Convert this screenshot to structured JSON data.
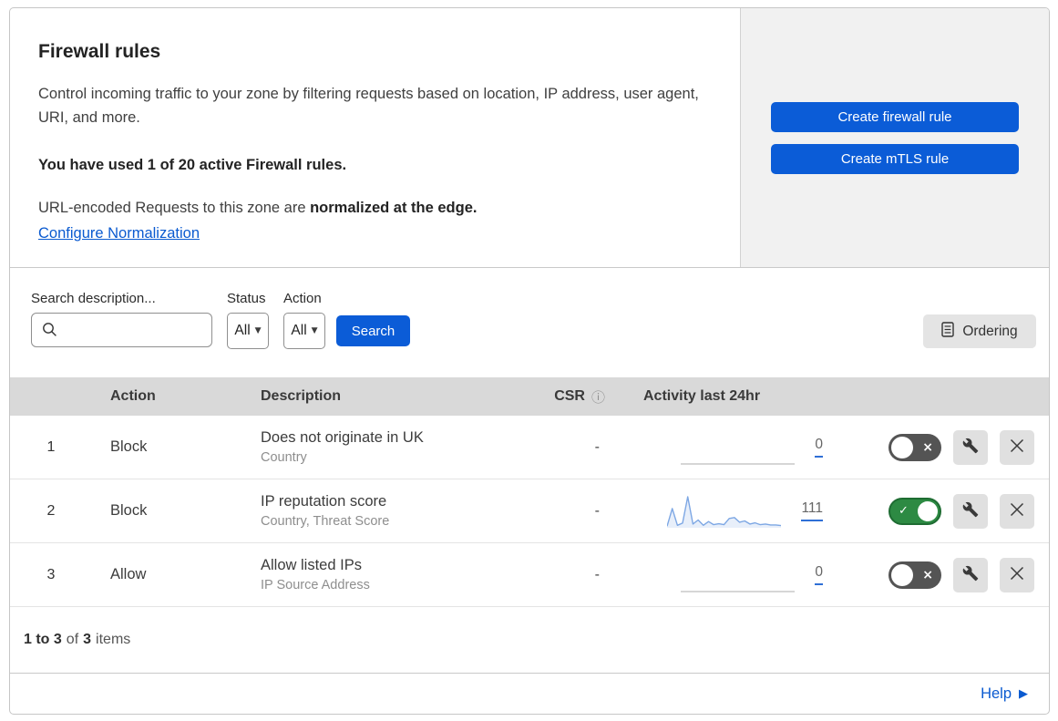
{
  "header": {
    "title": "Firewall rules",
    "description": "Control incoming traffic to your zone by filtering requests based on location, IP address, user agent, URI, and more.",
    "usage": "You have used 1 of 20 active Firewall rules.",
    "normalization_text": "URL-encoded Requests to this zone are ",
    "normalization_bold": "normalized at the edge.",
    "normalization_link": "Configure Normalization",
    "create_firewall_button": "Create firewall rule",
    "create_mtls_button": "Create mTLS rule"
  },
  "filters": {
    "search_label": "Search description...",
    "status_label": "Status",
    "status_value": "All",
    "action_label": "Action",
    "action_value": "All",
    "search_button": "Search",
    "ordering_button": "Ordering"
  },
  "table": {
    "columns": {
      "action": "Action",
      "description": "Description",
      "csr": "CSR",
      "activity": "Activity last 24hr"
    },
    "rows": [
      {
        "index": "1",
        "action": "Block",
        "description": "Does not originate in UK",
        "fields": "Country",
        "csr": "-",
        "activity_count": "0",
        "enabled": false,
        "sparkline": []
      },
      {
        "index": "2",
        "action": "Block",
        "description": "IP reputation score",
        "fields": "Country, Threat Score",
        "csr": "-",
        "activity_count": "111",
        "enabled": true,
        "sparkline": [
          5,
          62,
          8,
          15,
          100,
          12,
          25,
          8,
          20,
          10,
          13,
          10,
          30,
          33,
          18,
          22,
          12,
          16,
          10,
          12,
          9,
          9,
          7
        ]
      },
      {
        "index": "3",
        "action": "Allow",
        "description": "Allow listed IPs",
        "fields": "IP Source Address",
        "csr": "-",
        "activity_count": "0",
        "enabled": false,
        "sparkline": []
      }
    ]
  },
  "footer": {
    "range": "1 to 3",
    "of_label": "of",
    "total": "3",
    "items_label": "items",
    "help": "Help"
  },
  "colors": {
    "primary_blue": "#0b5cd7",
    "link_blue": "#0a5ad0",
    "toggle_on_green": "#2d8a43",
    "toggle_off_gray": "#545454",
    "sparkline_blue": "#7da7e4",
    "table_header_gray": "#d9d9d9",
    "panel_gray": "#f1f1f1"
  }
}
